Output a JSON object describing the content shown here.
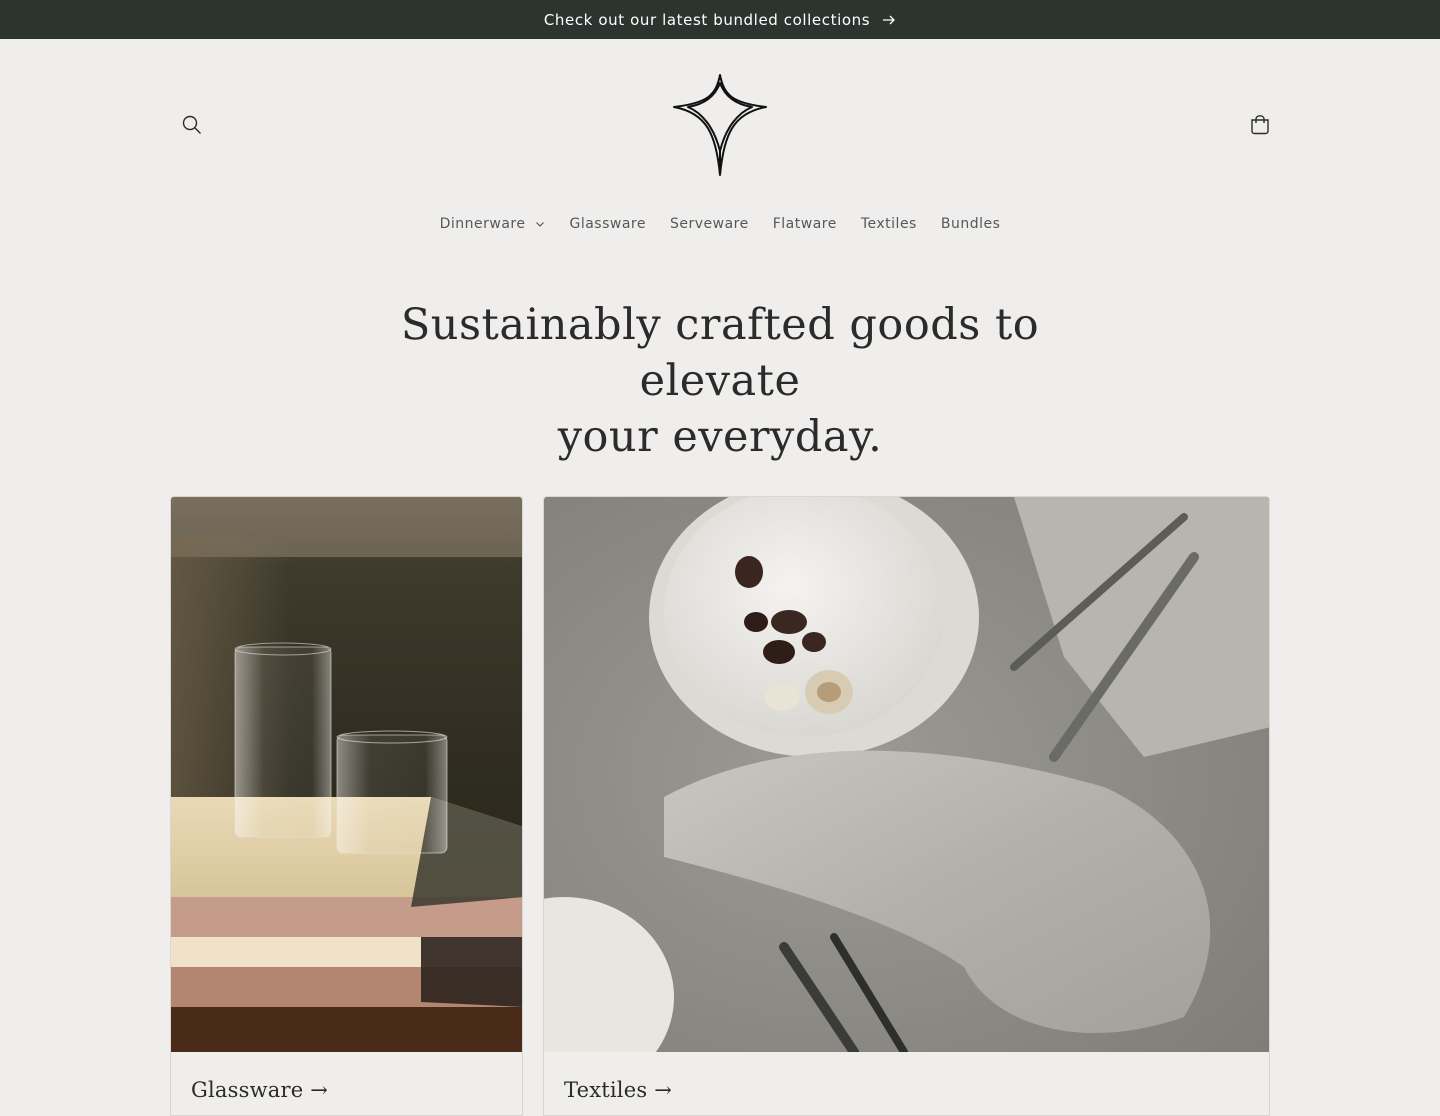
{
  "announcement": {
    "text": "Check out our latest bundled collections"
  },
  "header": {
    "search_icon": "search-icon",
    "cart_icon": "cart-icon",
    "logo": "star-diamond-logo"
  },
  "nav": {
    "items": [
      {
        "label": "Dinnerware",
        "has_dropdown": true
      },
      {
        "label": "Glassware"
      },
      {
        "label": "Serveware"
      },
      {
        "label": "Flatware"
      },
      {
        "label": "Textiles"
      },
      {
        "label": "Bundles"
      }
    ]
  },
  "hero": {
    "line1": "Sustainably crafted goods to elevate",
    "line2": "your everyday."
  },
  "collections": [
    {
      "title": "Glassware →"
    },
    {
      "title": "Textiles →"
    }
  ],
  "colors": {
    "announcement_bg": "#2c3430",
    "page_bg": "#efeeec",
    "text": "#2b2b2b"
  }
}
